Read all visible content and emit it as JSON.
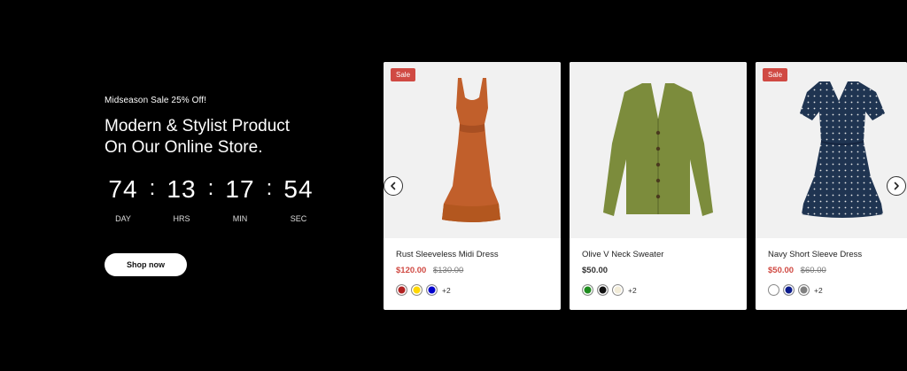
{
  "promo": {
    "eyebrow": "Midseason Sale 25% Off!",
    "headline_line1": "Modern & Stylist Product",
    "headline_line2": "On Our Online Store.",
    "countdown": [
      {
        "value": "74",
        "label": "DAY"
      },
      {
        "value": "13",
        "label": "HRS"
      },
      {
        "value": "17",
        "label": "MIN"
      },
      {
        "value": "54",
        "label": "SEC"
      }
    ],
    "separator": ":",
    "cta": "Shop now"
  },
  "carousel": {
    "prev_icon": "chevron-left-icon",
    "next_icon": "chevron-right-icon",
    "products": [
      {
        "badge": "Sale",
        "name": "Rust Sleeveless Midi Dress",
        "price": "$120.00",
        "old_price": "$130.00",
        "image": "rust-dress",
        "swatches": [
          "#b22222",
          "#ffd700",
          "#0000cd"
        ],
        "more": "+2"
      },
      {
        "badge": "",
        "name": "Olive V Neck Sweater",
        "price": "$50.00",
        "old_price": "",
        "image": "olive-cardigan",
        "swatches": [
          "#1e8c1e",
          "#111111",
          "#f2ecd8"
        ],
        "more": "+2"
      },
      {
        "badge": "Sale",
        "name": "Navy Short Sleeve Dress",
        "price": "$50.00",
        "old_price": "$60.00",
        "image": "navy-polka-dress",
        "swatches": [
          "#ffffff",
          "#0a1a8c",
          "#808080"
        ],
        "more": "+2"
      }
    ]
  },
  "colors": {
    "sale_badge": "#d04a43",
    "rust": "#c15f2b",
    "olive": "#7c8c3c",
    "navy": "#1f3451"
  }
}
